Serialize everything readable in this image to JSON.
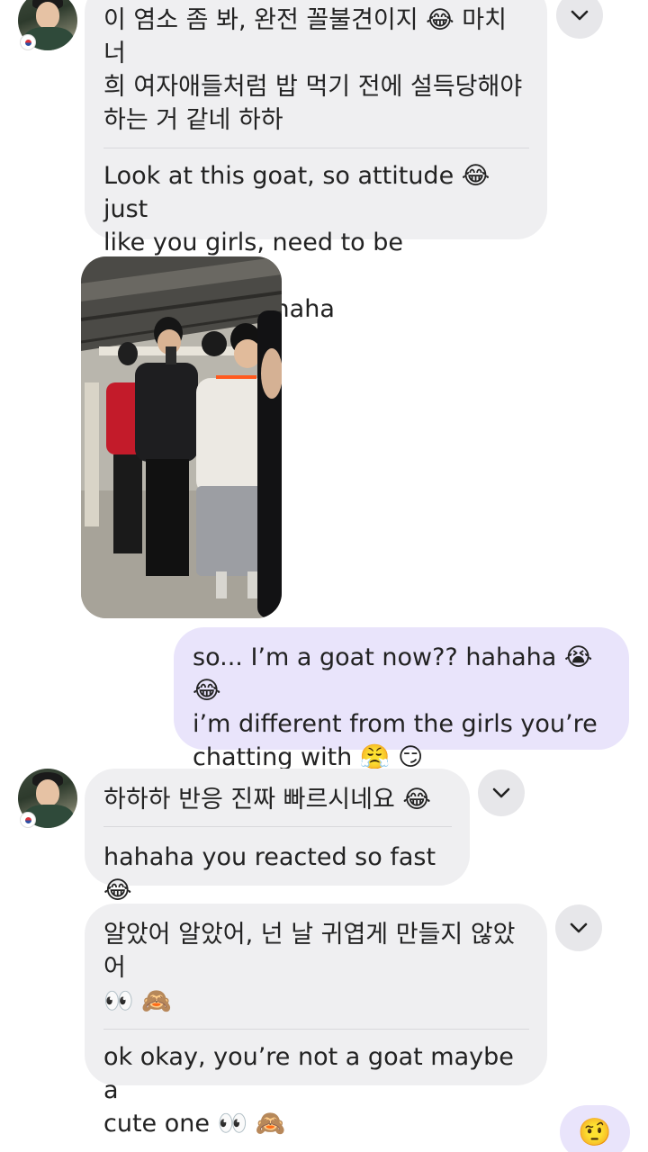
{
  "messages": [
    {
      "korean": "이 염소 좀 봐, 완전 꼴불견이지 😂 마치 너\n희 여자애들처럼 밥 먹기 전에 설득당해야\n하는 거 같네 하하",
      "english": "Look at this goat, so attitude 😂just\nlike you girls, need to be persuaded\nbefore eating haha"
    },
    {
      "text": "so... I’m a goat now?? hahaha 😭 😂\ni’m different from the girls you’re\nchatting with 😤 😏"
    },
    {
      "korean": "하하하 반응 진짜 빠르시네요 😂",
      "english": "hahaha you reacted so fast 😂"
    },
    {
      "korean": "알았어 알았어, 넌 날 귀엽게 만들지 않았어\n👀 🙈",
      "english": "ok okay, you’re not a goat maybe a\ncute one 👀 🙈"
    },
    {
      "text": "🤨"
    }
  ],
  "icons": {
    "translate_menu": "chevron-down-icon",
    "flag": "south-korea-flag-icon"
  },
  "colors": {
    "incoming_bubble": "#efeff1",
    "outgoing_bubble": "#e9e4fb",
    "chevron_button": "#e7e7ea"
  }
}
